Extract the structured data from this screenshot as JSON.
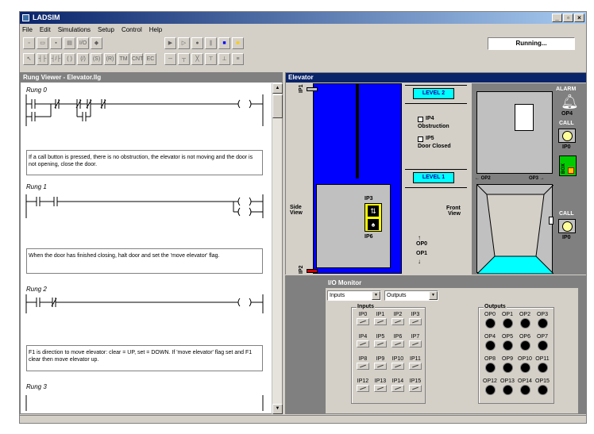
{
  "app": {
    "title": "LADSIM",
    "menu": [
      "File",
      "Edit",
      "Simulations",
      "Setup",
      "Control",
      "Help"
    ],
    "status": "Running..."
  },
  "rung_viewer": {
    "title": "Rung Viewer - Elevator.llg",
    "rungs": [
      {
        "label": "Rung 0",
        "description": "If a call button is pressed, there is no obstruction, the elevator is not moving and the door is not opening, close the door."
      },
      {
        "label": "Rung 1",
        "description": "When the door has finished closing, halt door and set the 'move elevator' flag."
      },
      {
        "label": "Rung 2",
        "description": "F1 is direction to move elevator: clear = UP, set = DOWN. If 'move elevator' flag set and F1 clear then move elevator up."
      },
      {
        "label": "Rung 3",
        "description": ""
      }
    ]
  },
  "elevator": {
    "title": "Elevator",
    "level2": "LEVEL 2",
    "level1": "LEVEL 1",
    "ip4": "IP4",
    "obstruction": "Obstruction",
    "ip5": "IP5",
    "door_closed": "Door Closed",
    "ip3": "IP3",
    "ip6": "IP6",
    "ip1": "IP1",
    "ip2": "IP2",
    "side_view": "Side\nView",
    "front_view": "Front\nView",
    "op0": "OP0",
    "op1": "OP1",
    "op2": "OP2",
    "op3": "OP3",
    "alarm": "ALARM",
    "op4": "OP4",
    "call": "CALL",
    "ip0": "IP0",
    "box": "BOX",
    "call2": "CALL",
    "ip0_2": "IP0",
    "colors": {
      "shaft": "#0000ff",
      "floor": "#00ffff",
      "led": "#ffff99",
      "box": "#00cc00"
    }
  },
  "io_monitor": {
    "title": "I/O Monitor",
    "input_select": "Inputs",
    "output_select": "Outputs",
    "inputs_label": "Inputs",
    "outputs_label": "Outputs",
    "inputs": [
      "IP0",
      "IP1",
      "IP2",
      "IP3",
      "IP4",
      "IP5",
      "IP6",
      "IP7",
      "IP8",
      "IP9",
      "IP10",
      "IP11",
      "IP12",
      "IP13",
      "IP14",
      "IP15"
    ],
    "outputs": [
      "OP0",
      "OP1",
      "OP2",
      "OP3",
      "OP4",
      "OP5",
      "OP6",
      "OP7",
      "OP8",
      "OP9",
      "OP10",
      "OP11",
      "OP12",
      "OP13",
      "OP14",
      "OP15"
    ]
  }
}
